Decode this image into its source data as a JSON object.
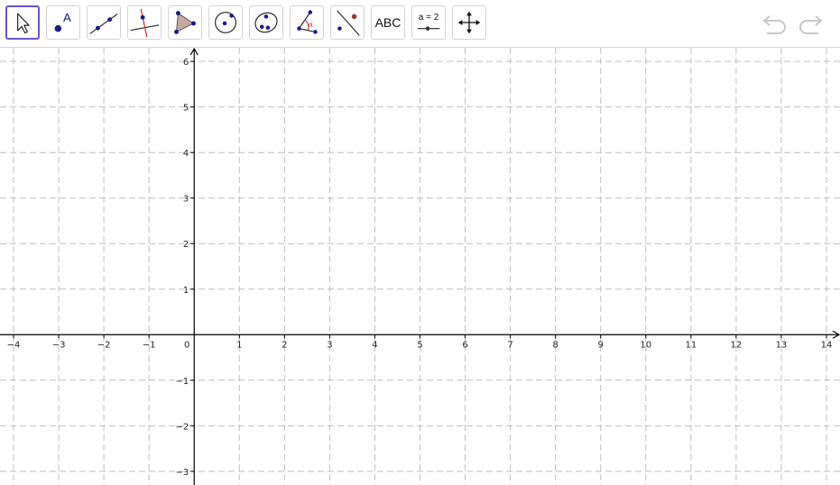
{
  "toolbar": {
    "tools": [
      {
        "icon": "move-arrow-icon",
        "selected": true
      },
      {
        "icon": "point-icon",
        "label": "A"
      },
      {
        "icon": "line-icon"
      },
      {
        "icon": "perpendicular-line-icon"
      },
      {
        "icon": "polygon-icon"
      },
      {
        "icon": "circle-center-point-icon"
      },
      {
        "icon": "conic-ellipse-icon"
      },
      {
        "icon": "angle-icon",
        "label": "α"
      },
      {
        "icon": "reflect-icon"
      },
      {
        "icon": "text-icon",
        "label": "ABC"
      },
      {
        "icon": "slider-icon",
        "label": "a = 2"
      },
      {
        "icon": "move-graphics-view-icon"
      }
    ],
    "undo_icon": "undo-icon",
    "redo_icon": "redo-icon"
  },
  "graphics_view": {
    "x_range": [
      -4.3,
      14.3
    ],
    "y_range": [
      -3.3,
      6.3
    ],
    "x_ticks": [
      "−4",
      "−3",
      "−2",
      "−1",
      "0",
      "1",
      "2",
      "3",
      "4",
      "5",
      "6",
      "7",
      "8",
      "9",
      "10",
      "11",
      "12",
      "13",
      "14"
    ],
    "y_ticks": [
      "−3",
      "−2",
      "−1",
      "1",
      "2",
      "3",
      "4",
      "5",
      "6"
    ],
    "grid": true,
    "grid_style": "dashed",
    "colors": {
      "grid": "#c0c0c0",
      "axis": "#000000",
      "point": "#1a1a8c",
      "accent": "#6557d2",
      "red": "#cc2222"
    }
  }
}
